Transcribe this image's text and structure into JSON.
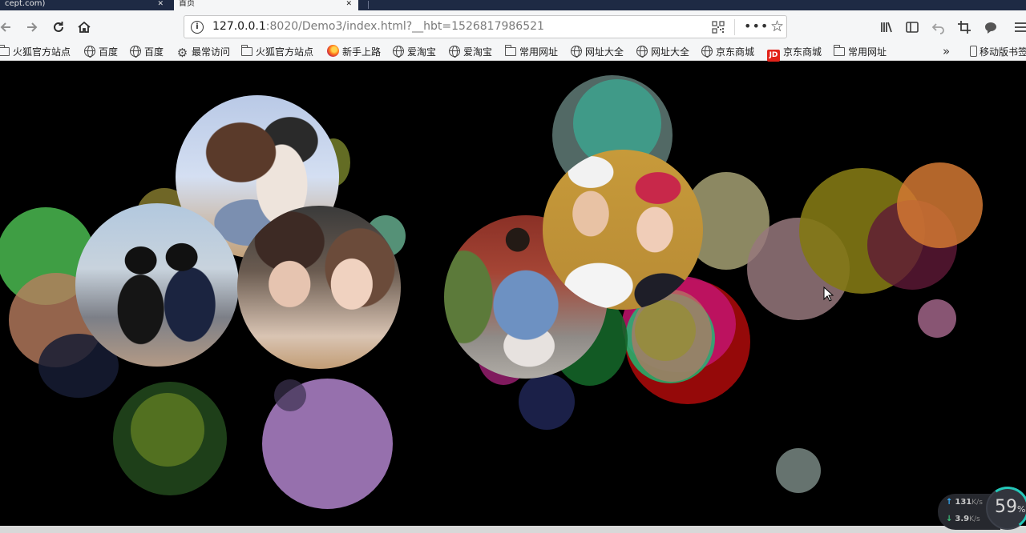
{
  "tabs": [
    {
      "label": "cept.com)",
      "close": "✕"
    },
    {
      "label": "首页",
      "close": "✕"
    }
  ],
  "nav": {
    "url_host": "127.0.0.1",
    "url_rest": ":8020/Demo3/index.html?__hbt=1526817986521",
    "more": "•••"
  },
  "bookmarks": [
    {
      "icon": "folder",
      "label": "火狐官方站点"
    },
    {
      "icon": "globe",
      "label": "百度"
    },
    {
      "icon": "globe",
      "label": "百度"
    },
    {
      "icon": "gear",
      "label": "最常访问"
    },
    {
      "icon": "folder",
      "label": "火狐官方站点"
    },
    {
      "icon": "firefox",
      "label": "新手上路"
    },
    {
      "icon": "globe",
      "label": "爱淘宝"
    },
    {
      "icon": "globe",
      "label": "爱淘宝"
    },
    {
      "icon": "folder",
      "label": "常用网址"
    },
    {
      "icon": "globe",
      "label": "网址大全"
    },
    {
      "icon": "globe",
      "label": "网址大全"
    },
    {
      "icon": "globe",
      "label": "京东商城"
    },
    {
      "icon": "jd",
      "label": "京东商城"
    },
    {
      "icon": "folder",
      "label": "常用网址"
    }
  ],
  "bookmarks_more": "»",
  "mobile_bookmarks": "移动版书签",
  "jd_badge": "JD",
  "speed": {
    "up_value": "131",
    "up_unit": "K/s",
    "down_value": "3.9",
    "down_unit": "K/s",
    "gauge_value": "59",
    "gauge_unit": "%"
  },
  "colors": {
    "page_background": "#000000",
    "toolbar_background": "#f5f6f7",
    "tabstrip_background": "#1e2a44"
  }
}
